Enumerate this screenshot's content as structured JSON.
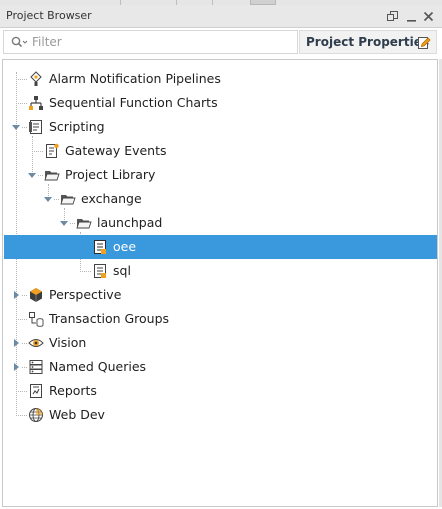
{
  "panel": {
    "title": "Project Browser",
    "controls": [
      "restore-icon",
      "minimize-icon",
      "close-icon"
    ]
  },
  "filter": {
    "placeholder": "Filter",
    "value": ""
  },
  "project_properties": {
    "label": "Project Properties",
    "icon": "project-properties-icon"
  },
  "tree": {
    "selected": "oee",
    "items": [
      {
        "label": "Alarm Notification Pipelines",
        "icon": "alarm-pipeline-icon",
        "depth": 0,
        "expandable": false
      },
      {
        "label": "Sequential Function Charts",
        "icon": "sfc-icon",
        "depth": 0,
        "expandable": false
      },
      {
        "label": "Scripting",
        "icon": "scripting-icon",
        "depth": 0,
        "expandable": true,
        "expanded": true
      },
      {
        "label": "Gateway Events",
        "icon": "gateway-events-icon",
        "depth": 1,
        "expandable": false
      },
      {
        "label": "Project Library",
        "icon": "folder-open-icon",
        "depth": 1,
        "expandable": true,
        "expanded": true
      },
      {
        "label": "exchange",
        "icon": "folder-open-icon",
        "depth": 2,
        "expandable": true,
        "expanded": true
      },
      {
        "label": "launchpad",
        "icon": "folder-open-icon",
        "depth": 3,
        "expandable": true,
        "expanded": true
      },
      {
        "label": "oee",
        "icon": "script-file-icon",
        "depth": 4,
        "expandable": false,
        "selected": true
      },
      {
        "label": "sql",
        "icon": "script-file-icon",
        "depth": 4,
        "expandable": false
      },
      {
        "label": "Perspective",
        "icon": "perspective-icon",
        "depth": 0,
        "expandable": true,
        "expanded": false
      },
      {
        "label": "Transaction Groups",
        "icon": "transaction-groups-icon",
        "depth": 0,
        "expandable": false
      },
      {
        "label": "Vision",
        "icon": "vision-icon",
        "depth": 0,
        "expandable": true,
        "expanded": false
      },
      {
        "label": "Named Queries",
        "icon": "named-queries-icon",
        "depth": 0,
        "expandable": true,
        "expanded": false
      },
      {
        "label": "Reports",
        "icon": "reports-icon",
        "depth": 0,
        "expandable": false
      },
      {
        "label": "Web Dev",
        "icon": "web-dev-icon",
        "depth": 0,
        "expandable": false
      }
    ]
  },
  "colors": {
    "selection": "#3a98dc",
    "header_bg": "#e8e8e8",
    "accent_orange": "#f0a020"
  }
}
